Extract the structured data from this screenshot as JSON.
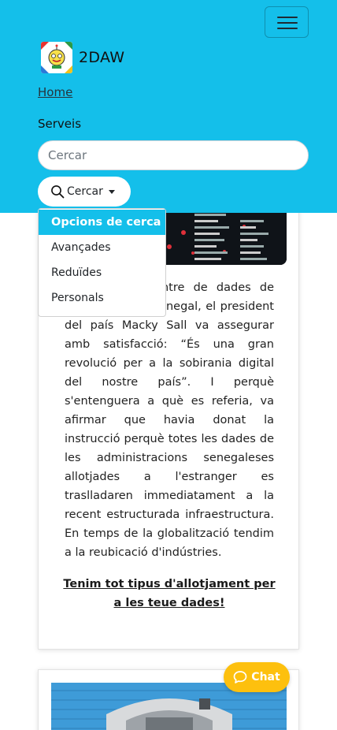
{
  "header": {
    "brand_name": "2DAW",
    "logo_icon": "robot-logo-icon",
    "menu_icon": "hamburger-menu-icon",
    "accent_color": "#14bfea"
  },
  "breadcrumb": {
    "home": "Home",
    "current": "Serveis"
  },
  "search": {
    "placeholder": "Cercar",
    "button_label": "Cercar",
    "button_icon": "search-icon"
  },
  "dropdown": {
    "items": [
      "Opcions de cerca",
      "Avançades",
      "Reduïdes",
      "Personals"
    ],
    "active_index": 0
  },
  "card1": {
    "body_text": "Inaugurar el centre de dades de Diamniadio, al Senegal, el president del país Macky Sall va assegurar amb satisfacció: “És una gran revolució per a la sobirania digital del nostre país”. I perquè s'entenguera a què es referia, va afirmar que havia donat la instrucció perquè totes les dades de les administracions senegaleses allotjades a l'estranger es traslladaren immediatament a la recent estructurada infraestructura. En temps de la globalització tendim a la reubicació d'indústries.",
    "cta": "Tenim tot tipus d'allotjament per a les teue dades!"
  },
  "chat": {
    "label": "Chat",
    "icon": "chat-bubble-icon",
    "color": "#fdc00e"
  }
}
